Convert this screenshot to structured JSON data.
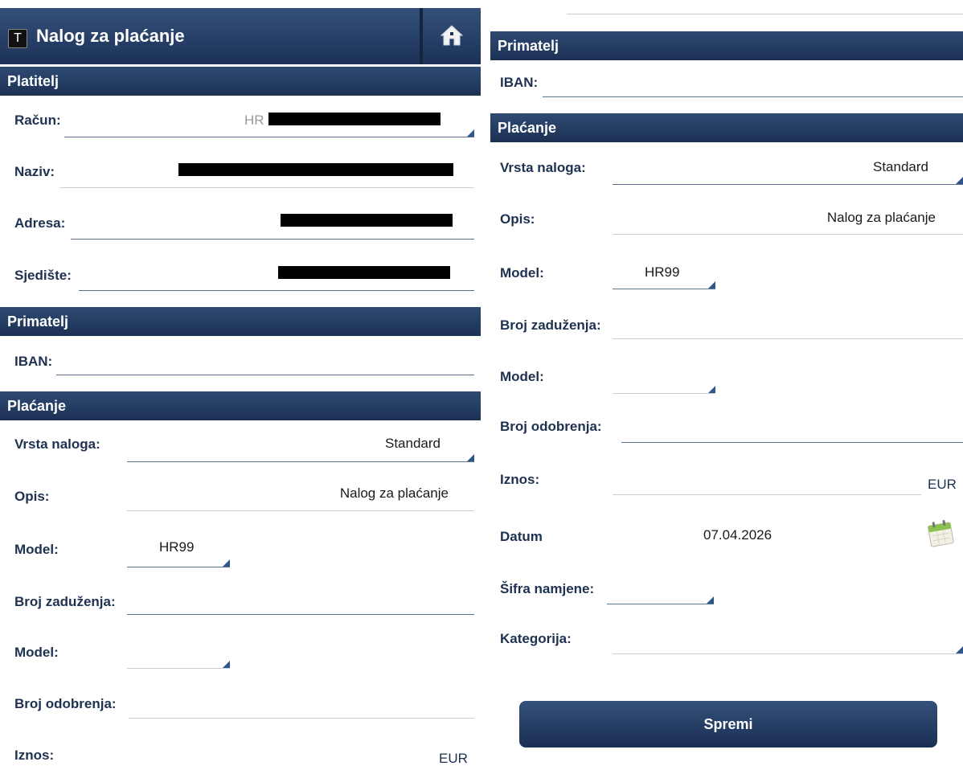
{
  "app": {
    "logo_letter": "T",
    "title": "Nalog za plaćanje",
    "home_icon": "home-icon"
  },
  "platitelj": {
    "section": "Platitelj",
    "racun_label": "Račun:",
    "racun_prefix": "HR",
    "naziv_label": "Naziv:",
    "adresa_label": "Adresa:",
    "sjediste_label": "Sjedište:"
  },
  "primatelj": {
    "section": "Primatelj",
    "iban_label": "IBAN:"
  },
  "placanje": {
    "section": "Plaćanje",
    "vrsta_label": "Vrsta naloga:",
    "vrsta_value": "Standard",
    "opis_label": "Opis:",
    "opis_value": "Nalog za plaćanje",
    "model_label": "Model:",
    "model_value": "HR99",
    "broj_zaduzenja_label": "Broj zaduženja:",
    "model2_label": "Model:",
    "broj_odobrenja_label": "Broj odobrenja:",
    "iznos_label": "Iznos:",
    "currency": "EUR",
    "datum_label": "Datum",
    "datum_value": "07.04.2026",
    "sifra_label": "Šifra namjene:",
    "kategorija_label": "Kategorija:"
  },
  "actions": {
    "save_label": "Spremi"
  },
  "colors": {
    "header": "#1c3257",
    "label": "#1e3150",
    "line": "#5f7391",
    "dropdown_marker": "#2f5688"
  }
}
